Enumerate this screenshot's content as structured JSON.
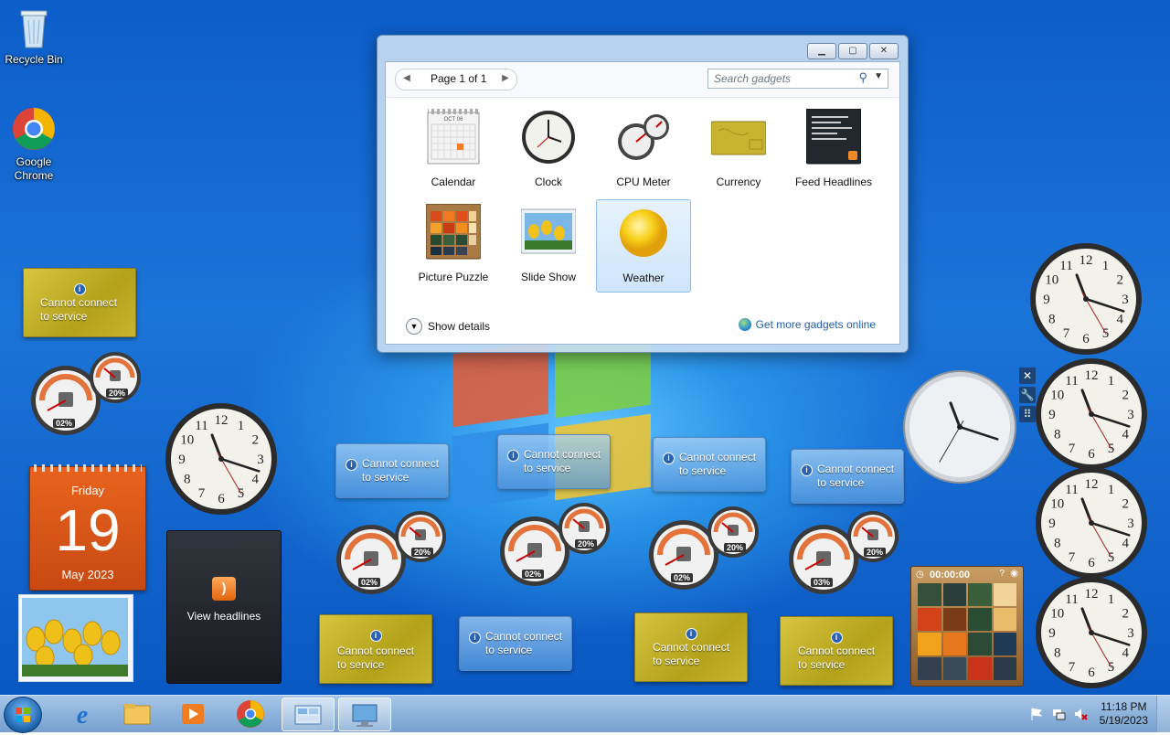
{
  "desktop": {
    "icons": [
      {
        "name": "recycle-bin",
        "label": "Recycle Bin"
      },
      {
        "name": "google-chrome",
        "label": "Google Chrome"
      }
    ]
  },
  "gadget_window": {
    "pager_text": "Page 1 of 1",
    "search_placeholder": "Search gadgets",
    "gadgets": [
      {
        "label": "Calendar"
      },
      {
        "label": "Clock"
      },
      {
        "label": "CPU Meter"
      },
      {
        "label": "Currency"
      },
      {
        "label": "Feed Headlines"
      },
      {
        "label": "Picture Puzzle"
      },
      {
        "label": "Slide Show"
      },
      {
        "label": "Weather"
      }
    ],
    "selected": "Weather",
    "show_details": "Show details",
    "get_more": "Get more gadgets online",
    "calendar_icon_month": "OCT 06"
  },
  "gadgets": {
    "service_error_line1": "Cannot connect",
    "service_error_line2": "to service",
    "cpu_meters": [
      {
        "cpu": "02%",
        "mem": "20%"
      },
      {
        "cpu": "02%",
        "mem": "20%"
      },
      {
        "cpu": "02%",
        "mem": "20%"
      },
      {
        "cpu": "02%",
        "mem": "20%"
      },
      {
        "cpu": "03%",
        "mem": "20%"
      }
    ],
    "calendar": {
      "weekday": "Friday",
      "day": "19",
      "month_year": "May 2023"
    },
    "feed": {
      "label": "View headlines"
    },
    "puzzle": {
      "timer": "00:00:00"
    },
    "clock_numerals": [
      "12",
      "1",
      "2",
      "3",
      "4",
      "5",
      "6",
      "7",
      "8",
      "9",
      "10",
      "11"
    ]
  },
  "taskbar": {
    "time": "11:18 PM",
    "date": "5/19/2023"
  },
  "colors": {
    "accent": "#1b74d8",
    "currency_gold": "#c9b52e",
    "calendar_orange": "#e8631d"
  }
}
